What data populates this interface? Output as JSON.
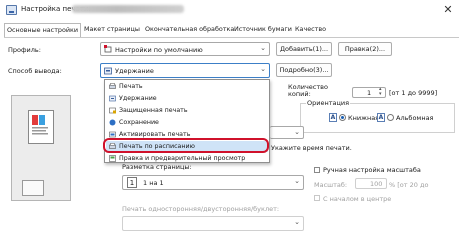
{
  "window": {
    "title": "Настройка печати: ",
    "close_glyph": "✕"
  },
  "tabs": [
    "Основные настройки",
    "Макет страницы",
    "Окончательная обработка",
    "Источник бумаги",
    "Качество"
  ],
  "profile": {
    "label": "Профиль:",
    "value": "Настройки по умолчанию",
    "add_button": "Добавить(1)...",
    "edit_button": "Правка(2)..."
  },
  "output": {
    "label": "Способ вывода:",
    "value": "Удержание",
    "details_button": "Подробно(3)..."
  },
  "dropdown_items": [
    {
      "label": "Печать",
      "icon": "print-icon"
    },
    {
      "label": "Удержание",
      "icon": "hold-icon"
    },
    {
      "label": "Защищенная печать",
      "icon": "secure-print-icon"
    },
    {
      "label": "Сохранение",
      "icon": "save-icon"
    },
    {
      "label": "Активировать печать",
      "icon": "activate-print-icon"
    },
    {
      "label": "Печать по расписанию",
      "icon": "scheduled-print-icon"
    },
    {
      "label": "Правка и предварительный просмотр",
      "icon": "edit-preview-icon"
    }
  ],
  "selected_item_index": 5,
  "copies": {
    "label": "Количество копий:",
    "value": "1",
    "range": "[от 1 до 9999]"
  },
  "orientation": {
    "label": "Ориентация",
    "portrait_glyph": "A",
    "portrait": "Книжная",
    "landscape_glyph": "A",
    "landscape": "Альбомная",
    "selected": "portrait"
  },
  "time_hint": "Укажите время печати.",
  "layout": {
    "label": "Разметка страницы:",
    "icon_text": "1",
    "value": "1 на 1"
  },
  "manual_scale": {
    "label": "Ручная настройка масштаба",
    "scale_label": "Масштаб:",
    "scale_value": "100",
    "scale_range": "% [от 20 до"
  },
  "duplex_label": "Печать односторонняя/двусторонняя/буклет:",
  "start_center": "С началом в центре",
  "accent_color": "#d0112b"
}
